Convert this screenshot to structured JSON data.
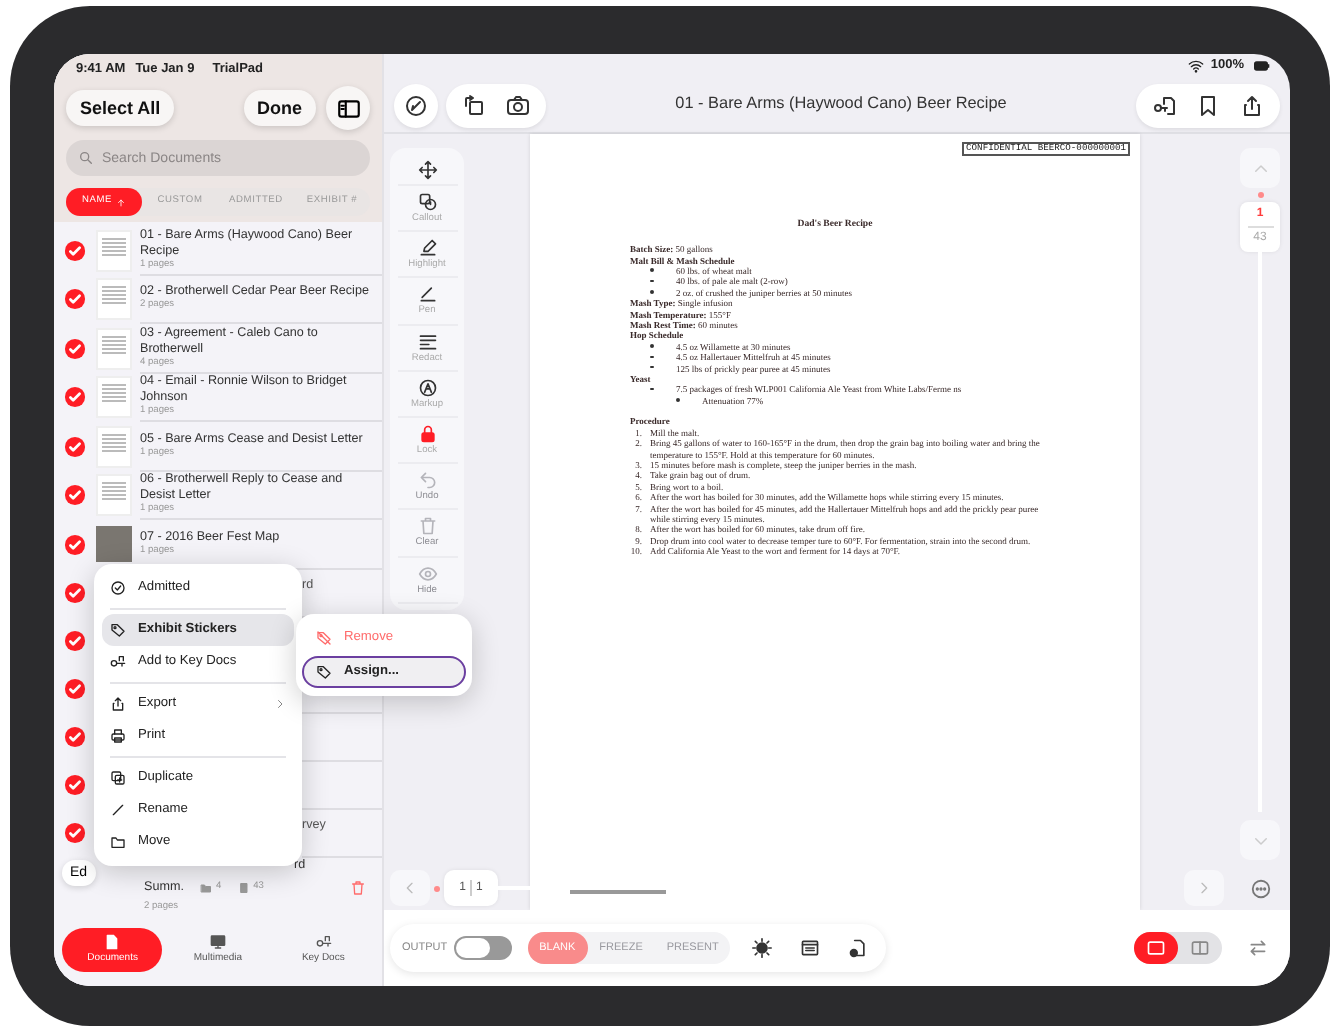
{
  "status_bar": {
    "time": "9:41 AM",
    "date": "Tue Jan 9",
    "app": "TrialPad",
    "battery": "100%"
  },
  "sidebar": {
    "select_all": "Select All",
    "done": "Done",
    "search": {
      "placeholder": "Search Documents"
    },
    "sort_tabs": [
      {
        "label": "NAME",
        "selected": true
      },
      {
        "label": "CUSTOM",
        "selected": false
      },
      {
        "label": "ADMITTED",
        "selected": false
      },
      {
        "label": "EXHIBIT #",
        "selected": false
      }
    ],
    "documents": [
      {
        "title": "01 - Bare Arms (Haywood Cano) Beer Recipe",
        "pages": "1 pages",
        "checked": true,
        "kind": "document"
      },
      {
        "title": "02 - Brotherwell Cedar Pear Beer Recipe",
        "pages": "2 pages",
        "checked": true,
        "kind": "document"
      },
      {
        "title": "03 - Agreement - Caleb Cano to Brotherwell",
        "pages": "4 pages",
        "checked": true,
        "kind": "document"
      },
      {
        "title": "04 - Email - Ronnie Wilson to Bridget Johnson",
        "pages": "1 pages",
        "checked": true,
        "kind": "document"
      },
      {
        "title": "05 - Bare Arms Cease and Desist Letter",
        "pages": "1 pages",
        "checked": true,
        "kind": "document"
      },
      {
        "title": "06 - Brotherwell Reply to Cease and Desist Letter",
        "pages": "1 pages",
        "checked": true,
        "kind": "document"
      },
      {
        "title": "07 - 2016 Beer Fest Map",
        "pages": "1 pages",
        "checked": true,
        "kind": "photo"
      }
    ],
    "covered_documents": [
      {
        "title": "rd",
        "checked": true
      },
      {
        "checked": true
      },
      {
        "checked": true
      },
      {
        "checked": true
      },
      {
        "checked": true
      },
      {
        "title": "rvey",
        "checked": true
      }
    ],
    "last_document": {
      "title": "rd",
      "subtitle": "Summ.",
      "pages": "2 pages",
      "counts": [
        "4",
        "43"
      ]
    },
    "edit_button": "Ed",
    "bottom_tabs": [
      {
        "label": "Documents",
        "selected": true
      },
      {
        "label": "Multimedia",
        "selected": false
      },
      {
        "label": "Key Docs",
        "selected": false
      }
    ]
  },
  "context_menu": {
    "sections": [
      [
        {
          "label": "Admitted",
          "highlighted": false,
          "has_submenu": false
        }
      ],
      [
        {
          "label": "Exhibit Stickers",
          "highlighted": true,
          "has_submenu": false
        },
        {
          "label": "Add to Key Docs",
          "highlighted": false,
          "has_submenu": false
        }
      ],
      [
        {
          "label": "Export",
          "highlighted": false,
          "has_submenu": true
        },
        {
          "label": "Print",
          "highlighted": false,
          "has_submenu": false
        }
      ],
      [
        {
          "label": "Duplicate",
          "highlighted": false,
          "has_submenu": false
        },
        {
          "label": "Rename",
          "highlighted": false,
          "has_submenu": false
        },
        {
          "label": "Move",
          "highlighted": false,
          "has_submenu": false
        }
      ]
    ],
    "submenu": [
      {
        "label": "Remove",
        "kind": "destructive",
        "focused": false
      },
      {
        "label": "Assign...",
        "kind": "default",
        "focused": true
      }
    ]
  },
  "viewer": {
    "title": "01 - Bare Arms (Haywood Cano) Beer Recipe",
    "tools": [
      {
        "label": "Callout",
        "active": false,
        "disabled": false
      },
      {
        "label": "Highlight",
        "active": false,
        "disabled": false
      },
      {
        "label": "Pen",
        "active": false,
        "disabled": false
      },
      {
        "label": "Redact",
        "active": false,
        "disabled": false
      },
      {
        "label": "Markup",
        "active": false,
        "disabled": false
      },
      {
        "label": "Lock",
        "active": true,
        "disabled": false
      },
      {
        "label": "Undo",
        "active": false,
        "disabled": true
      },
      {
        "label": "Clear",
        "active": false,
        "disabled": true
      },
      {
        "label": "Hide",
        "active": false,
        "disabled": true
      }
    ],
    "document": {
      "stamp": "CONFIDENTIAL BEERCO-000000001",
      "heading": "Dad's Beer Recipe",
      "blocks": [
        {
          "kind": "line",
          "text": "**Batch Size:** 50 gallons"
        },
        {
          "kind": "heading",
          "text": "Malt Bill & Mash Schedule"
        },
        {
          "kind": "bullet",
          "text": "60 lbs. of wheat malt"
        },
        {
          "kind": "bullet",
          "text": "40 lbs. of pale ale malt (2-row)"
        },
        {
          "kind": "bullet",
          "text": "2 oz. of crushed the juniper berries at 50 minutes"
        },
        {
          "kind": "line",
          "text": "**Mash Type:** Single infusion"
        },
        {
          "kind": "line",
          "text": "**Mash Temperature:** 155°F"
        },
        {
          "kind": "line",
          "text": "**Mash Rest Time:** 60 minutes"
        },
        {
          "kind": "heading",
          "text": "Hop Schedule"
        },
        {
          "kind": "bullet",
          "text": "4.5 oz Willamette at 30 minutes"
        },
        {
          "kind": "bullet",
          "text": "4.5 oz Hallertauer Mittelfruh at 45 minutes"
        },
        {
          "kind": "bullet",
          "text": "125 lbs of prickly pear puree at 45 minutes"
        },
        {
          "kind": "heading",
          "text": "Yeast"
        },
        {
          "kind": "bullet",
          "text": "7.5 packages of fresh WLP001 California Ale Yeast from White Labs/Ferme  ns"
        },
        {
          "kind": "subbullet",
          "text": "Attenuation 77%"
        },
        {
          "kind": "heading",
          "text": "Procedure"
        },
        {
          "kind": "numbered",
          "number": "1.",
          "text": "Mill the malt."
        },
        {
          "kind": "numbered",
          "number": "2.",
          "text": "Bring 45 gallons of water to 160-165°F in the drum, then drop the grain bag into boiling water and bring the temperature to 155°F. Hold at this temperature for 60 minutes."
        },
        {
          "kind": "numbered",
          "number": "3.",
          "text": "15 minutes before mash is complete, steep the juniper berries in the mash."
        },
        {
          "kind": "numbered",
          "number": "4.",
          "text": "Take grain bag out of drum."
        },
        {
          "kind": "numbered",
          "number": "5.",
          "text": "Bring wort to a boil."
        },
        {
          "kind": "numbered",
          "number": "6.",
          "text": "After the wort has boiled for 30 minutes, add the Willamette hops while stirring every 15 minutes."
        },
        {
          "kind": "numbered",
          "number": "7.",
          "text": "After the wort has boiled for 45 minutes, add the Hallertauer Mittelfruh hops and add the prickly pear puree while stirring every 15 minutes."
        },
        {
          "kind": "numbered",
          "number": "8.",
          "text": "After the wort has boiled for 60 minutes, take drum off fire."
        },
        {
          "kind": "numbered",
          "number": "9.",
          "text": "Drop drum into cool water to decrease temper  ture to 60°F. For fermentation, strain into the second drum."
        },
        {
          "kind": "numbered",
          "number": "10.",
          "text": "Add California Ale Yeast to the wort and ferment for 14 days at 70°F."
        }
      ]
    },
    "page_nav": {
      "page": "1",
      "total": "1"
    },
    "page_rail": {
      "current": "1",
      "count": "43"
    }
  },
  "bottom_bar": {
    "output_label": "OUTPUT",
    "output_on": false,
    "modes": [
      {
        "label": "BLANK",
        "selected": true
      },
      {
        "label": "FREEZE",
        "selected": false
      },
      {
        "label": "PRESENT",
        "selected": false
      }
    ],
    "layouts": [
      {
        "selected": true
      },
      {
        "selected": false
      }
    ]
  }
}
